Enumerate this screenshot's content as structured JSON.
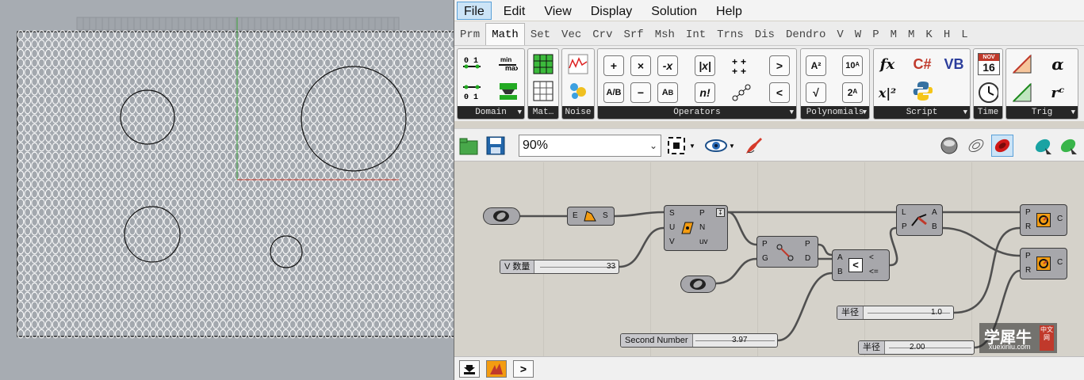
{
  "menu": [
    "File",
    "Edit",
    "View",
    "Display",
    "Solution",
    "Help"
  ],
  "tabs": [
    "Prm",
    "Math",
    "Set",
    "Vec",
    "Crv",
    "Srf",
    "Msh",
    "Int",
    "Trns",
    "Dis",
    "Dendro",
    "V",
    "W",
    "P",
    "M",
    "M",
    "K",
    "H",
    "L"
  ],
  "ribbon": {
    "groups": [
      "Domain",
      "Mat…",
      "Noise",
      "Operators",
      "Polynomials",
      "Script",
      "Time",
      "Trig"
    ],
    "calendar": {
      "month": "NOV",
      "day": "16"
    }
  },
  "toolbar": {
    "zoom": "90%"
  },
  "components": {
    "ex_input": "E",
    "ex_output": "S",
    "eval_inputs": [
      "S",
      "U",
      "V"
    ],
    "eval_outputs": [
      "P",
      "N",
      "uv"
    ],
    "cp_inputs": [
      "P",
      "G"
    ],
    "cp_outputs": [
      "P",
      "D"
    ],
    "cmp_inputs": [
      "A",
      "B"
    ],
    "cmp_outputs": [
      "<",
      "<="
    ],
    "dispatch_inputs": [
      "L",
      "P"
    ],
    "dispatch_outputs": [
      "A",
      "B"
    ],
    "circle_inputs": [
      "P",
      "R"
    ],
    "circle_output": "C"
  },
  "sliders": {
    "v_count": {
      "name": "V 数量",
      "value": "33"
    },
    "second_number": {
      "name": "Second Number",
      "value": "3.97"
    },
    "radius_a": {
      "name": "半径",
      "value": "1.0"
    },
    "radius_b": {
      "name": "半径",
      "value": "2.00"
    }
  },
  "watermark": {
    "brand": "学犀牛",
    "url": "xuexiniu.com",
    "tag": "中文网"
  },
  "colors": {
    "canvas": "#d5d2ca",
    "component": "#a7a7ab",
    "active_tab": "#cce4f7"
  }
}
